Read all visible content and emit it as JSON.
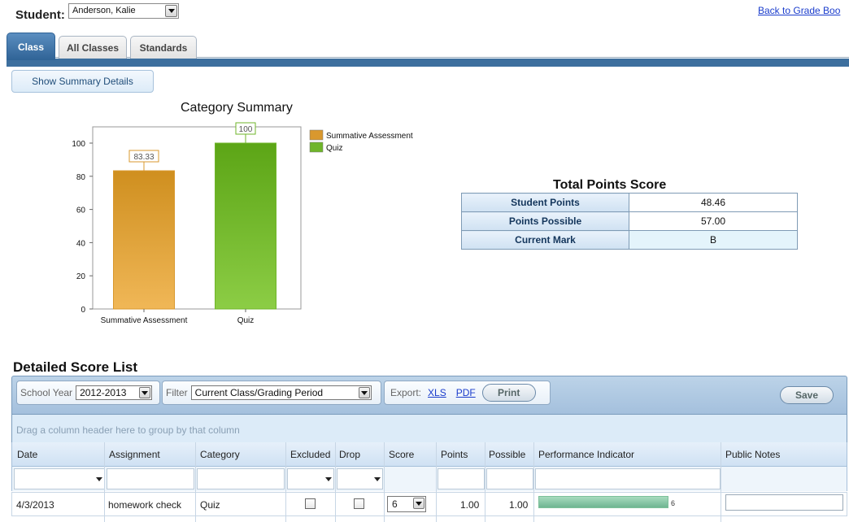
{
  "header": {
    "student_label": "Student:",
    "student_value": "Anderson, Kalie",
    "back_link": "Back to Grade Boo"
  },
  "tabs": [
    {
      "label": "Class",
      "active": true
    },
    {
      "label": "All Classes",
      "active": false
    },
    {
      "label": "Standards",
      "active": false
    }
  ],
  "summary_button": "Show Summary Details",
  "chart_data": {
    "type": "bar",
    "title": "Category Summary",
    "categories": [
      "Summative Assessment",
      "Quiz"
    ],
    "values": [
      83.33,
      100
    ],
    "data_labels": [
      "83.33",
      "100"
    ],
    "colors": [
      "#d9982e",
      "#6fb52a"
    ],
    "ylim": [
      0,
      100
    ],
    "yticks": [
      "0",
      "20",
      "40",
      "60",
      "80",
      "100"
    ],
    "legend": [
      "Summative Assessment",
      "Quiz"
    ],
    "legend_position": "right",
    "grid": false
  },
  "total_points": {
    "title": "Total Points Score",
    "rows": [
      {
        "label": "Student Points",
        "value": "48.46"
      },
      {
        "label": "Points Possible",
        "value": "57.00"
      },
      {
        "label": "Current Mark",
        "value": "B"
      }
    ]
  },
  "detailed": {
    "title": "Detailed Score List",
    "school_year_label": "School Year",
    "school_year_value": "2012-2013",
    "filter_label": "Filter",
    "filter_value": "Current Class/Grading Period",
    "export_label": "Export:",
    "export_xls": "XLS",
    "export_pdf": "PDF",
    "print": "Print",
    "save": "Save",
    "group_hint": "Drag a column header here to group by that column",
    "columns": [
      "Date",
      "Assignment",
      "Category",
      "Excluded",
      "Drop",
      "Score",
      "Points",
      "Possible",
      "Performance Indicator",
      "Public Notes"
    ],
    "rows": [
      {
        "date": "4/3/2013",
        "assignment": "homework check",
        "category": "Quiz",
        "score": "6",
        "points": "1.00",
        "possible": "1.00",
        "performance_value": "6",
        "performance_fraction": 1.0
      }
    ]
  }
}
